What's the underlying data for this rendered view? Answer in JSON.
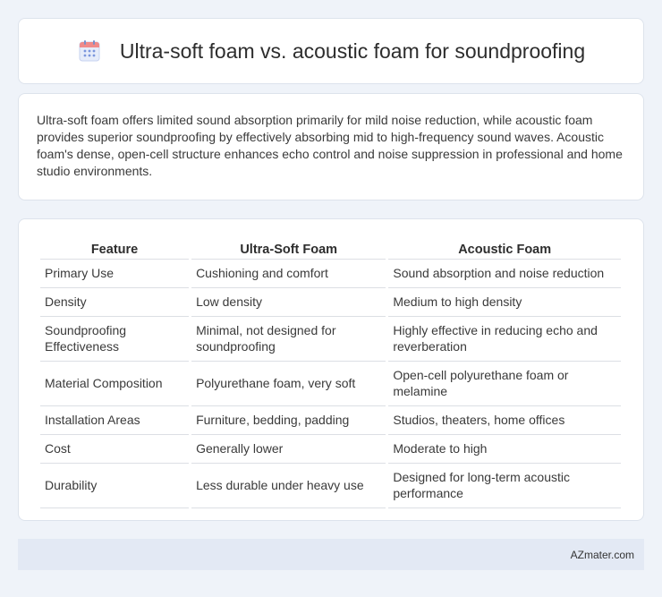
{
  "header": {
    "title": "Ultra-soft foam vs. acoustic foam for soundproofing",
    "icon": "calendar-icon"
  },
  "summary": {
    "text": "Ultra-soft foam offers limited sound absorption primarily for mild noise reduction, while acoustic foam provides superior soundproofing by effectively absorbing mid to high-frequency sound waves. Acoustic foam's dense, open-cell structure enhances echo control and noise suppression in professional and home studio environments."
  },
  "table": {
    "headers": [
      "Feature",
      "Ultra-Soft Foam",
      "Acoustic Foam"
    ],
    "rows": [
      [
        "Primary Use",
        "Cushioning and comfort",
        "Sound absorption and noise reduction"
      ],
      [
        "Density",
        "Low density",
        "Medium to high density"
      ],
      [
        "Soundproofing Effectiveness",
        "Minimal, not designed for soundproofing",
        "Highly effective in reducing echo and reverberation"
      ],
      [
        "Material Composition",
        "Polyurethane foam, very soft",
        "Open-cell polyurethane foam or melamine"
      ],
      [
        "Installation Areas",
        "Furniture, bedding, padding",
        "Studios, theaters, home offices"
      ],
      [
        "Cost",
        "Generally lower",
        "Moderate to high"
      ],
      [
        "Durability",
        "Less durable under heavy use",
        "Designed for long-term acoustic performance"
      ]
    ]
  },
  "footer": {
    "text": "AZmater.com"
  },
  "colors": {
    "background": "#eff3f9",
    "card": "#ffffff",
    "footer": "#e3e9f4",
    "icon_accent": "#6f8fd8"
  }
}
